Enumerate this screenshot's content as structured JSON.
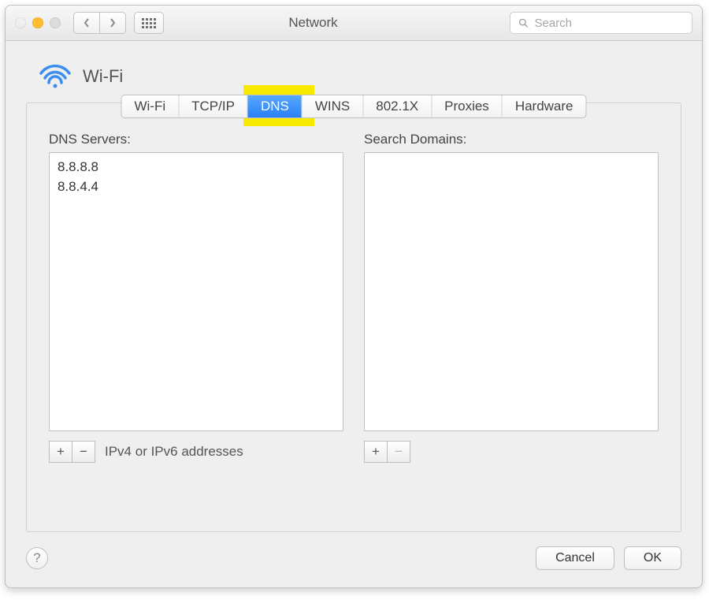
{
  "window": {
    "title": "Network",
    "traffic_colors": {
      "close": "#ff5f57",
      "minimize": "#ffbd2e",
      "zoom": "#dcdcdc"
    }
  },
  "search": {
    "placeholder": "Search",
    "value": ""
  },
  "header": {
    "connection_name": "Wi-Fi"
  },
  "tabs": {
    "items": [
      "Wi-Fi",
      "TCP/IP",
      "DNS",
      "WINS",
      "802.1X",
      "Proxies",
      "Hardware"
    ],
    "active_index": 2
  },
  "dns": {
    "servers_label": "DNS Servers:",
    "servers": [
      "8.8.8.8",
      "8.8.4.4"
    ],
    "hint": "IPv4 or IPv6 addresses",
    "search_domains_label": "Search Domains:",
    "search_domains": []
  },
  "buttons": {
    "help": "?",
    "plus": "+",
    "minus": "−",
    "cancel": "Cancel",
    "ok": "OK"
  }
}
